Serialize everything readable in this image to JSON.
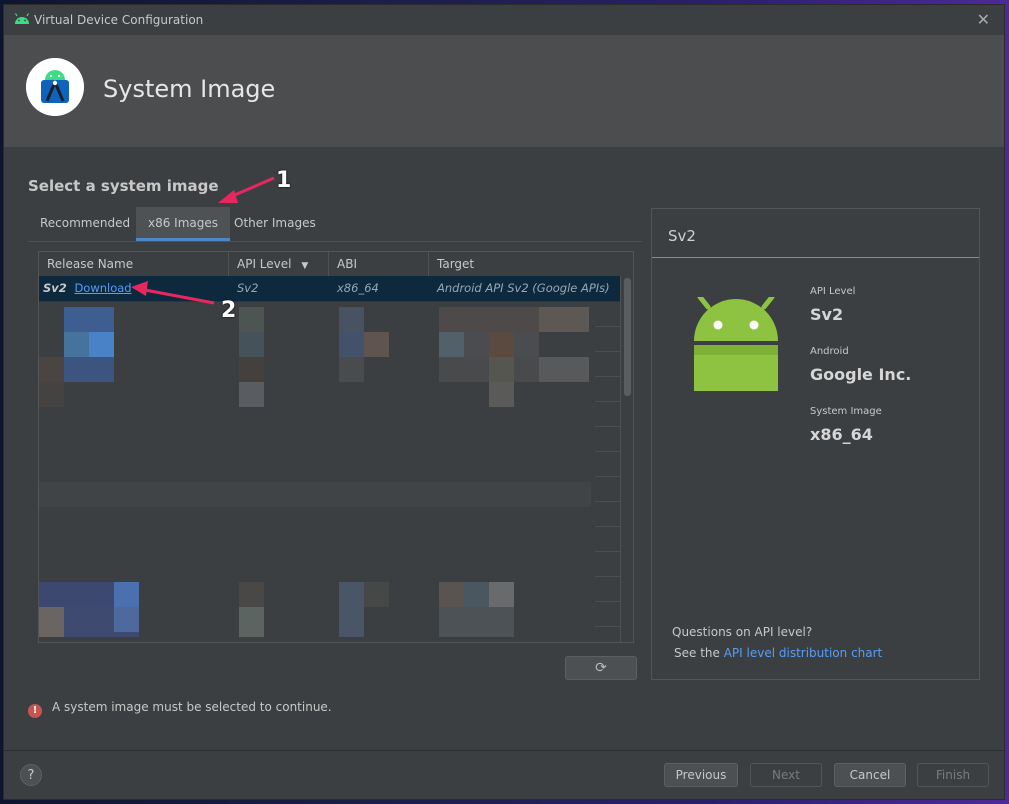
{
  "window": {
    "title": "Virtual Device Configuration",
    "close_glyph": "✕"
  },
  "header": {
    "title": "System Image"
  },
  "section": {
    "title": "Select a system image"
  },
  "tabs": [
    {
      "label": "Recommended",
      "active": false
    },
    {
      "label": "x86 Images",
      "active": true
    },
    {
      "label": "Other Images",
      "active": false
    }
  ],
  "table": {
    "columns": [
      "Release Name",
      "API Level",
      "ABI",
      "Target"
    ],
    "sort_icon": "▼",
    "selected_row": {
      "release": "Sv2",
      "download": "Download",
      "api_level": "Sv2",
      "abi": "x86_64",
      "target": "Android API Sv2 (Google APIs)"
    }
  },
  "refresh_button": {
    "glyph": "⟳"
  },
  "warning": {
    "icon": "!",
    "text": "A system image must be selected to continue."
  },
  "details": {
    "title": "Sv2",
    "api_level_label": "API Level",
    "api_level_value": "Sv2",
    "android_label": "Android",
    "android_value": "Google Inc.",
    "system_image_label": "System Image",
    "system_image_value": "x86_64",
    "question": "Questions on API level?",
    "see_prefix": "See the",
    "link": "API level distribution chart"
  },
  "footer": {
    "help": "?",
    "previous": "Previous",
    "next": "Next",
    "cancel": "Cancel",
    "finish": "Finish"
  },
  "annotations": {
    "one": "1",
    "two": "2"
  },
  "colors": {
    "accent": "#4a88c7",
    "link": "#589df6",
    "android_green": "#8dc341",
    "annotation_arrow": "#e8275f"
  }
}
